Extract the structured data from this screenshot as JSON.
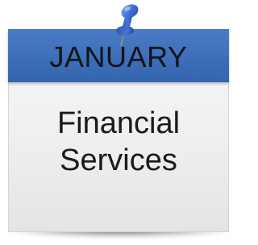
{
  "card": {
    "month": "JANUARY",
    "title_line1": "Financial",
    "title_line2": "Services"
  },
  "colors": {
    "header": "#3c6db8",
    "pin": "#3f6fd0",
    "card": "#f2f2f2",
    "text": "#1a1a1a"
  },
  "icons": {
    "pin": "push-pin-icon"
  }
}
